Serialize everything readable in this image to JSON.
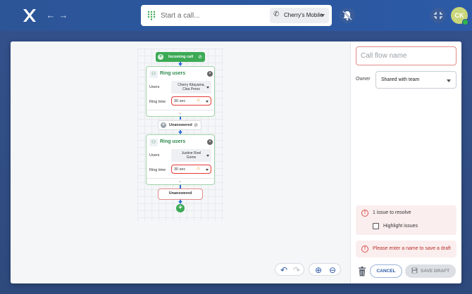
{
  "topbar": {
    "search_placeholder": "Start a call...",
    "line_select_value": "Cherry's Mobile",
    "avatar_initials": "CK"
  },
  "flow": {
    "incoming_label": "Incoming call",
    "nodes": [
      {
        "title": "Ring users",
        "users_label": "Users",
        "users_value_line1": "Cherry Kitayama,",
        "users_value_line2": "Clea Perez",
        "ring_label": "Ring time",
        "ring_value": "30 sec"
      },
      {
        "title": "Ring users",
        "users_label": "Users",
        "users_value_line1": "Justine Roel",
        "users_value_line2": "Gome",
        "ring_label": "Ring time",
        "ring_value": "30 sec"
      }
    ],
    "unanswered_mid_label": "Unanswered",
    "unanswered_end_label": "Unanswered"
  },
  "panel": {
    "name_placeholder": "Call flow name",
    "owner_label": "Owner",
    "owner_value": "Shared with team",
    "issues_title": "1 issue to resolve",
    "highlight_label": "Highlight issues",
    "draft_error": "Please enter a name to save a draft",
    "cancel_label": "CANCEL",
    "save_label": "SAVE DRAFT"
  },
  "colors": {
    "accent": "#2b59a5",
    "success": "#3caa55",
    "error": "#d9534f"
  }
}
